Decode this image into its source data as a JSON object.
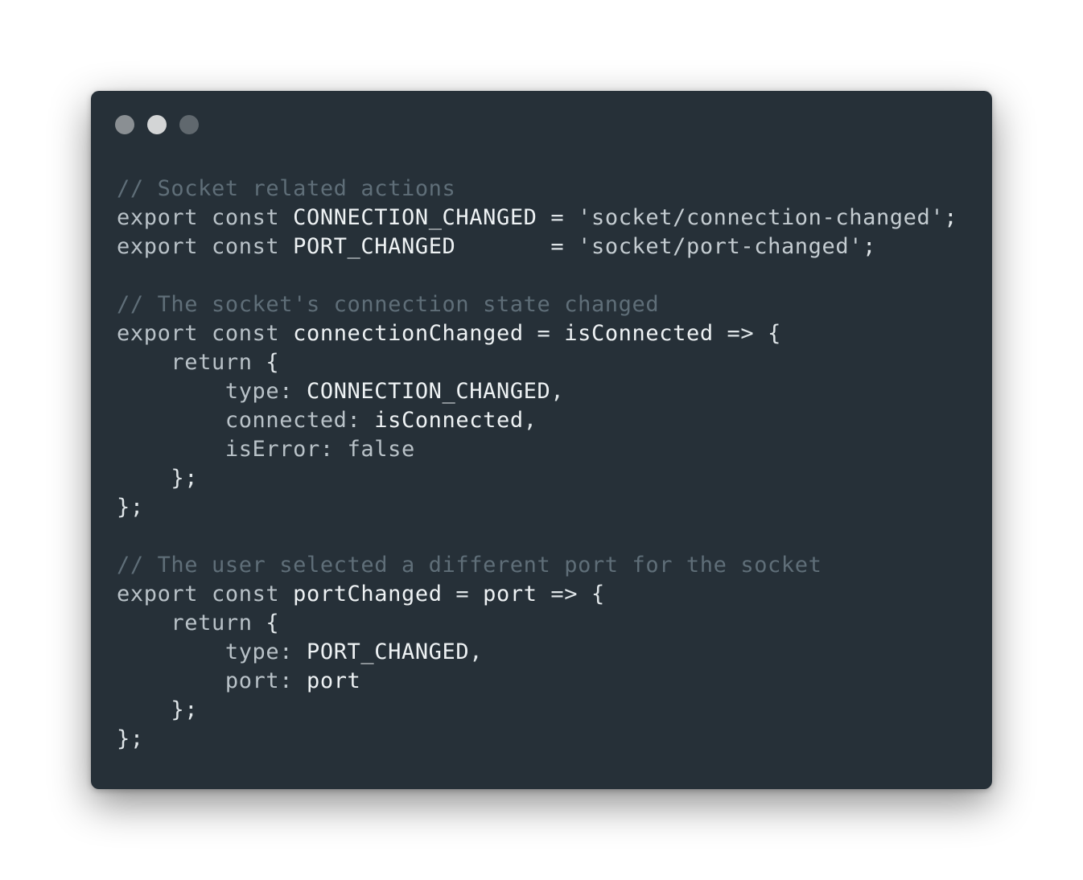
{
  "window": {
    "traffic_lights": [
      {
        "name": "close",
        "color": "#8a8f93"
      },
      {
        "name": "minimize",
        "color": "#d3d5d6"
      },
      {
        "name": "zoom",
        "color": "#60686e"
      }
    ],
    "background_color": "#263038"
  },
  "code": {
    "language": "javascript",
    "lines": [
      "// Socket related actions",
      "export const CONNECTION_CHANGED = 'socket/connection-changed';",
      "export const PORT_CHANGED       = 'socket/port-changed';",
      "",
      "// The socket's connection state changed",
      "export const connectionChanged = isConnected => {",
      "    return {",
      "        type: CONNECTION_CHANGED,",
      "        connected: isConnected,",
      "        isError: false",
      "    };",
      "};",
      "",
      "// The user selected a different port for the socket",
      "export const portChanged = port => {",
      "    return {",
      "        type: PORT_CHANGED,",
      "        port: port",
      "    };",
      "};"
    ]
  }
}
